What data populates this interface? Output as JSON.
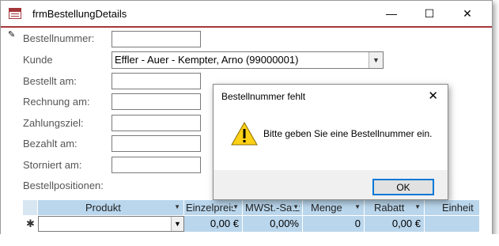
{
  "window": {
    "title": "frmBestellungDetails",
    "minimize": "—",
    "maximize": "☐",
    "close": "✕"
  },
  "form": {
    "record_icon": "✎",
    "bestellnummer_label": "Bestellnummer:",
    "bestellnummer_value": "",
    "kunde_label": "Kunde",
    "kunde_value": "Effler - Auer - Kempter, Arno (99000001)",
    "bestellt_label": "Bestellt am:",
    "rechnung_label": "Rechnung am:",
    "zahlungsziel_label": "Zahlungsziel:",
    "bezahlt_label": "Bezahlt am:",
    "storniert_label": "Storniert am:",
    "positionen_label": "Bestellpositionen:"
  },
  "grid": {
    "columns": [
      "Produkt",
      "Einzelpreis",
      "MWSt.-Satz",
      "Menge",
      "Rabatt",
      "Einheit"
    ],
    "new_row_marker": "✱",
    "row": {
      "produkt": "",
      "einzelpreis": "0,00 €",
      "mwst": "0,00%",
      "menge": "0",
      "rabatt": "0,00 €",
      "einheit": ""
    }
  },
  "dialog": {
    "title": "Bestellnummer fehlt",
    "message": "Bitte geben Sie eine Bestellnummer ein.",
    "ok_label": "OK",
    "icon": "warning-icon"
  },
  "colors": {
    "accent": "#a4373a",
    "grid_header": "#bad6ec",
    "button_focus": "#0078d7"
  }
}
